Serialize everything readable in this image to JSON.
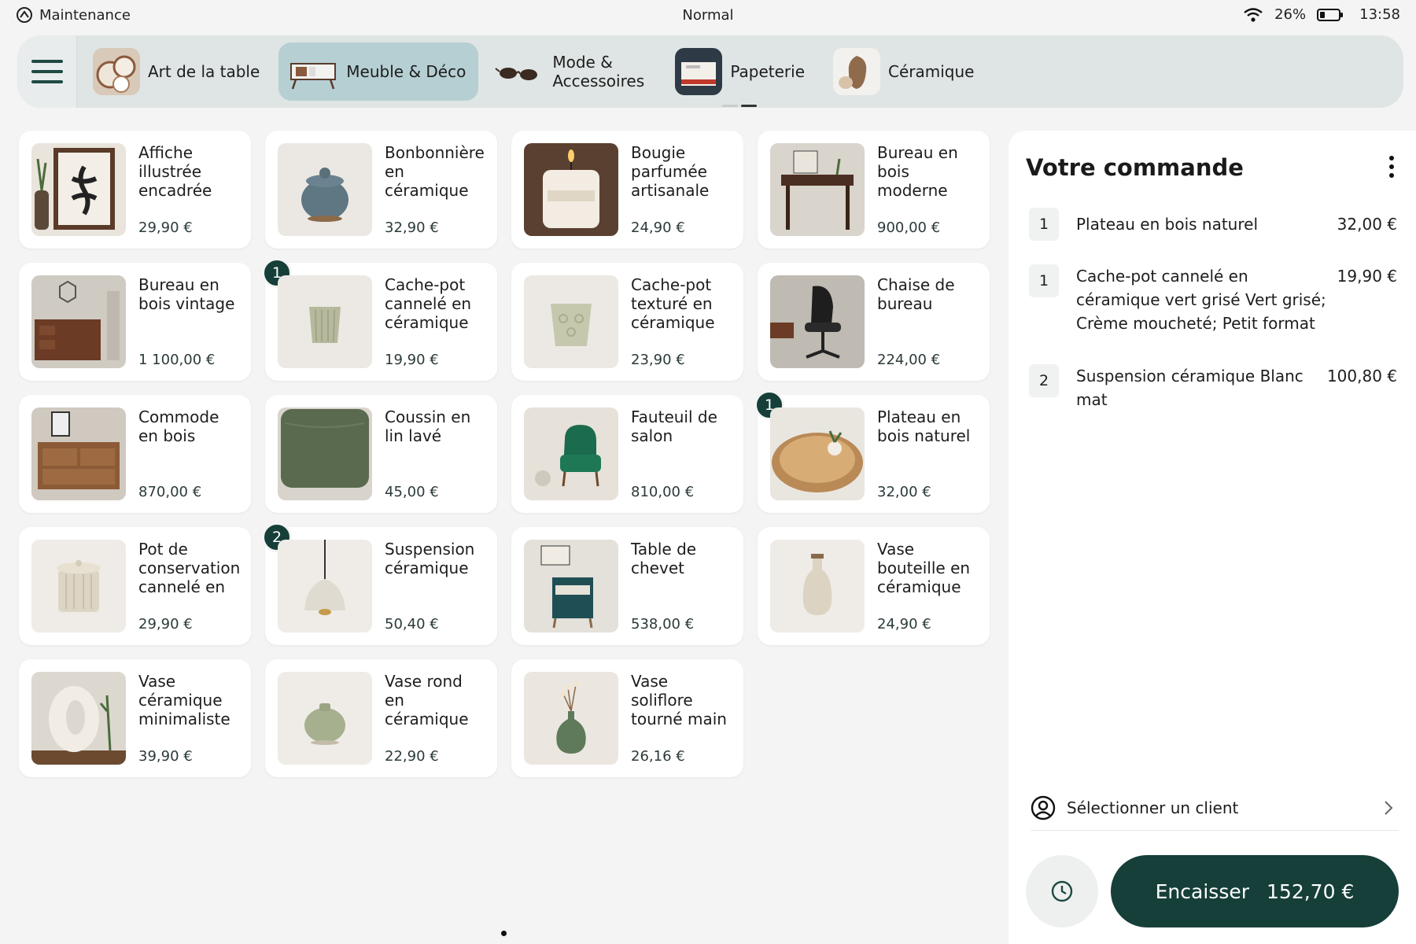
{
  "status_bar": {
    "app_mode": "Maintenance",
    "center": "Normal",
    "battery": "26%",
    "battery_level": 0.26,
    "time": "13:58"
  },
  "categories": [
    {
      "label": "Art de la table",
      "active": false
    },
    {
      "label": "Meuble & Déco",
      "active": true
    },
    {
      "label": "Mode & Accessoires",
      "active": false
    },
    {
      "label": "Papeterie",
      "active": false
    },
    {
      "label": "Céramique",
      "active": false
    }
  ],
  "products": [
    {
      "name": "Affiche illustrée encadrée",
      "price": "29,90 €",
      "badge": ""
    },
    {
      "name": "Bonbonnière en céramique",
      "price": "32,90 €",
      "badge": ""
    },
    {
      "name": "Bougie parfumée artisanale",
      "price": "24,90 €",
      "badge": ""
    },
    {
      "name": "Bureau en bois moderne",
      "price": "900,00 €",
      "badge": ""
    },
    {
      "name": "Bureau en bois vintage",
      "price": "1 100,00 €",
      "badge": ""
    },
    {
      "name": "Cache-pot cannelé en céramique",
      "price": "19,90 €",
      "badge": "1"
    },
    {
      "name": "Cache-pot texturé en céramique",
      "price": "23,90 €",
      "badge": ""
    },
    {
      "name": "Chaise de bureau",
      "price": "224,00 €",
      "badge": ""
    },
    {
      "name": "Commode en bois",
      "price": "870,00 €",
      "badge": ""
    },
    {
      "name": "Coussin en lin lavé",
      "price": "45,00 €",
      "badge": ""
    },
    {
      "name": "Fauteuil de salon",
      "price": "810,00 €",
      "badge": ""
    },
    {
      "name": "Plateau en bois naturel",
      "price": "32,00 €",
      "badge": "1"
    },
    {
      "name": "Pot de conservation cannelé en",
      "price": "29,90 €",
      "badge": ""
    },
    {
      "name": "Suspension céramique",
      "price": "50,40 €",
      "badge": "2"
    },
    {
      "name": "Table de chevet",
      "price": "538,00 €",
      "badge": ""
    },
    {
      "name": "Vase bouteille en céramique",
      "price": "24,90 €",
      "badge": ""
    },
    {
      "name": "Vase céramique minimaliste",
      "price": "39,90 €",
      "badge": ""
    },
    {
      "name": "Vase rond en céramique",
      "price": "22,90 €",
      "badge": ""
    },
    {
      "name": "Vase soliflore tourné main",
      "price": "26,16 €",
      "badge": ""
    }
  ],
  "order": {
    "title": "Votre commande",
    "lines": [
      {
        "qty": "1",
        "name": "Plateau en bois naturel",
        "price": "32,00 €"
      },
      {
        "qty": "1",
        "name": "Cache-pot cannelé en céramique vert grisé Vert grisé; Crème moucheté; Petit format",
        "price": "19,90 €"
      },
      {
        "qty": "2",
        "name": "Suspension céramique Blanc mat",
        "price": "100,80 €"
      }
    ],
    "client_label": "Sélectionner un client",
    "pay_label": "Encaisser",
    "total": "152,70 €"
  },
  "colors": {
    "accent": "#163f3a",
    "category_bar": "#dfe5e4",
    "active_category": "#b6cfd3",
    "background": "#f4f4f4"
  }
}
